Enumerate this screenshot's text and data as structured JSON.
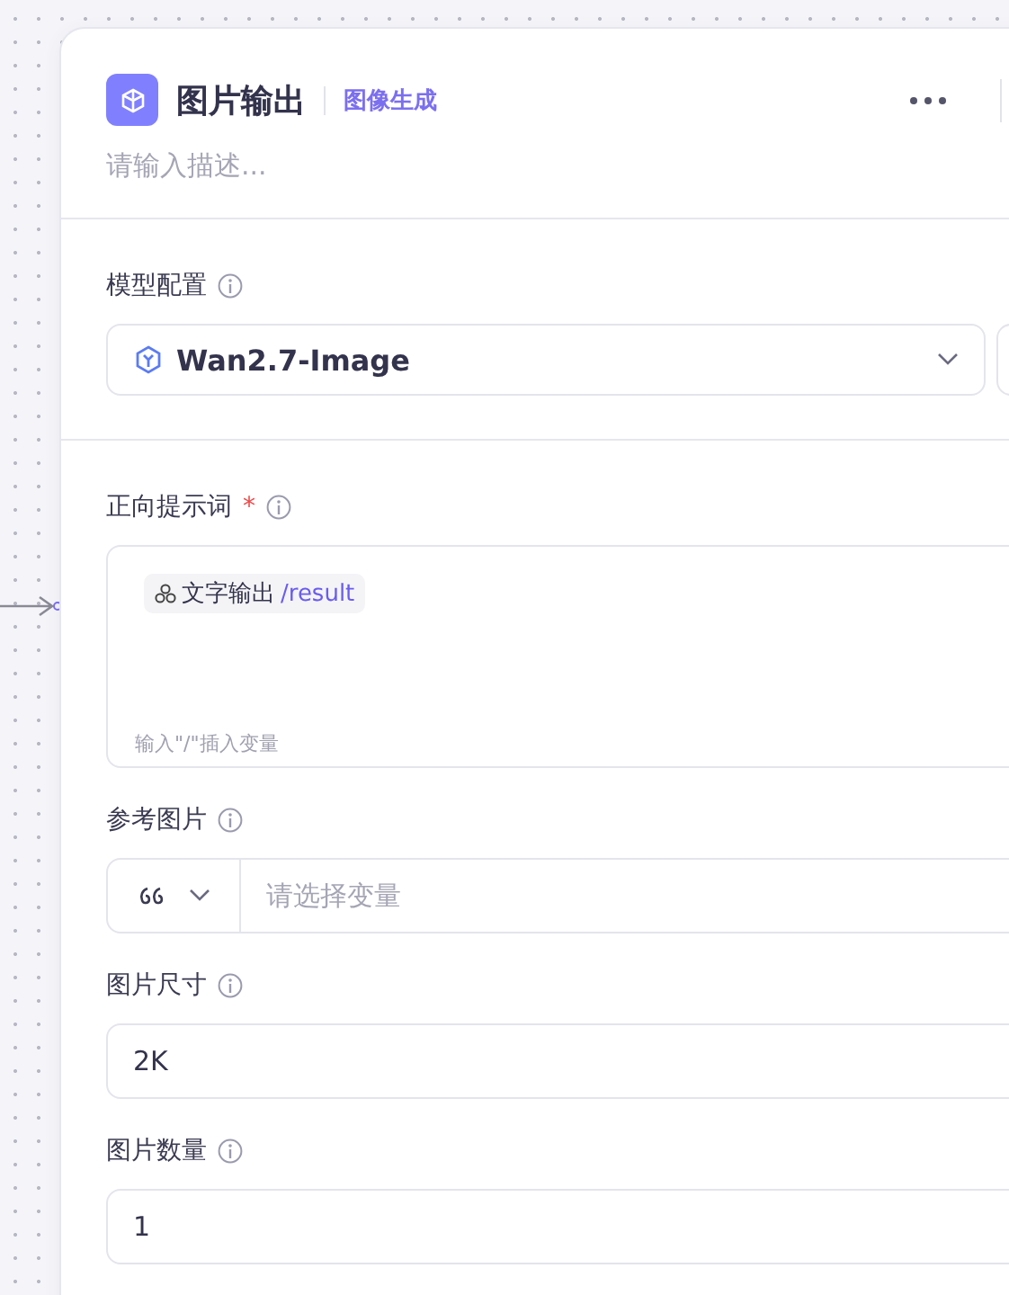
{
  "node": {
    "title": "图片输出",
    "type_tag": "图像生成",
    "description_placeholder": "请输入描述..."
  },
  "model": {
    "label": "模型配置",
    "value": "Wan2.7-Image"
  },
  "fields": [
    {
      "kind": "prompt",
      "label": "正向提示词",
      "required_mark": "*",
      "chip_name": "文字输出",
      "chip_path": "/result",
      "hint": "输入\"/\"插入变量"
    },
    {
      "kind": "variable",
      "label": "参考图片",
      "placeholder": "请选择变量"
    },
    {
      "kind": "value",
      "label": "图片尺寸",
      "value": "2K"
    },
    {
      "kind": "value",
      "label": "图片数量",
      "value": "1"
    }
  ]
}
